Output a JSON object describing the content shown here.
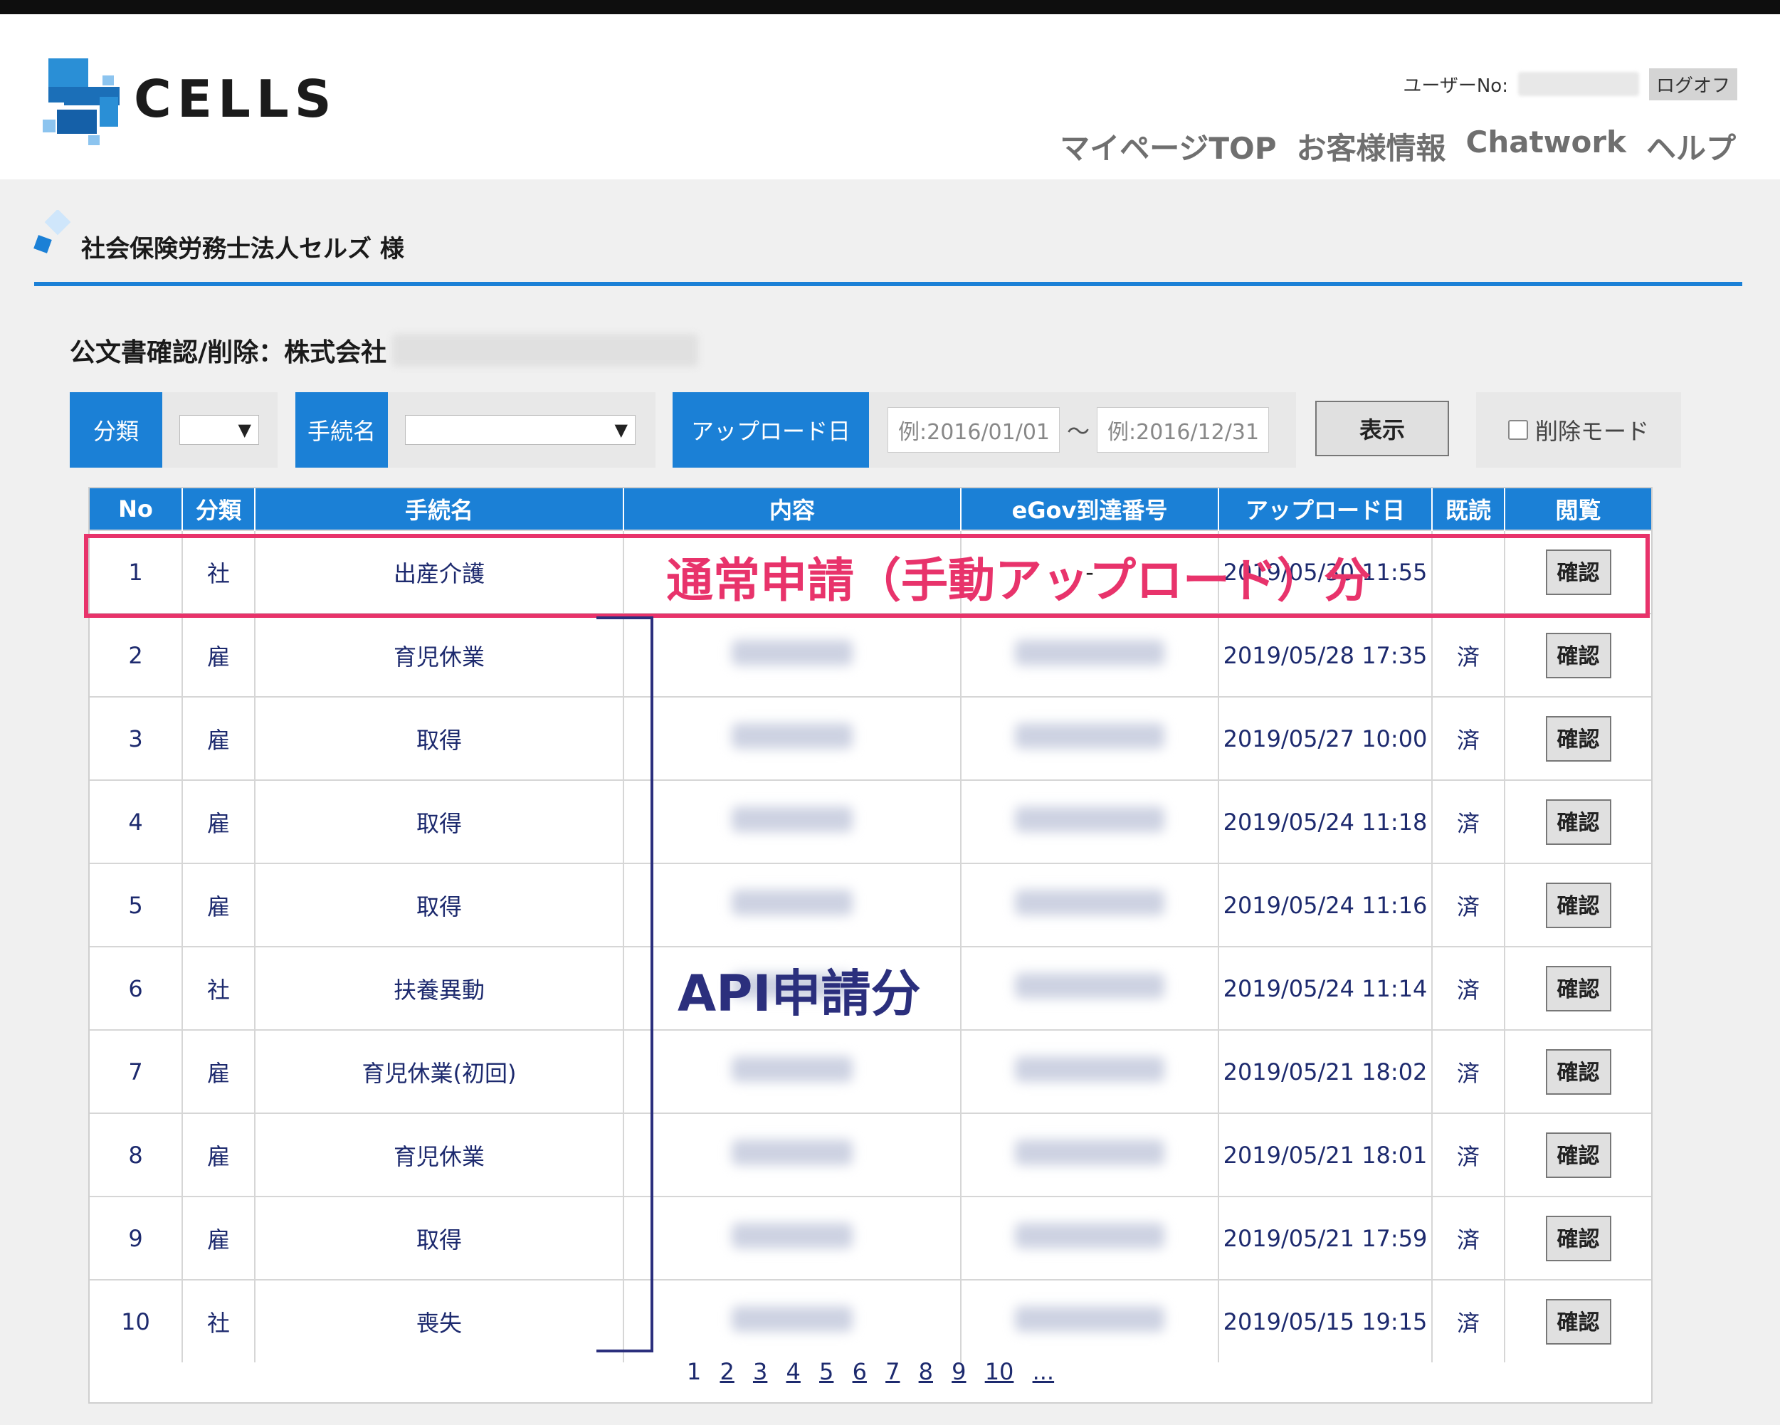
{
  "header": {
    "logo_text": "CELLS",
    "user_label": "ユーザーNo:",
    "logoff_label": "ログオフ",
    "nav": [
      "マイページTOP",
      "お客様情報",
      "Chatwork",
      "ヘルプ"
    ]
  },
  "customer": {
    "name": "社会保険労務士法人セルズ 様"
  },
  "doc_title": "公文書確認/削除：株式会社",
  "filters": {
    "category_label": "分類",
    "procedure_label": "手続名",
    "upload_label": "アップロード日",
    "date_from_placeholder": "例:2016/01/01",
    "tilde": "〜",
    "date_to_placeholder": "例:2016/12/31",
    "show_button": "表示",
    "delete_mode_label": "削除モード"
  },
  "table": {
    "headers": [
      "No",
      "分類",
      "手続名",
      "内容",
      "eGov到達番号",
      "アップロード日",
      "既読",
      "閲覧"
    ],
    "confirm_label": "確認",
    "rows": [
      {
        "no": "1",
        "category": "社",
        "procedure": "出産介護",
        "content": "",
        "egov": "-",
        "upload": "2019/05/30 11:55",
        "read": ""
      },
      {
        "no": "2",
        "category": "雇",
        "procedure": "育児休業",
        "content": "",
        "egov": "",
        "upload": "2019/05/28 17:35",
        "read": "済"
      },
      {
        "no": "3",
        "category": "雇",
        "procedure": "取得",
        "content": "",
        "egov": "",
        "upload": "2019/05/27 10:00",
        "read": "済"
      },
      {
        "no": "4",
        "category": "雇",
        "procedure": "取得",
        "content": "",
        "egov": "",
        "upload": "2019/05/24 11:18",
        "read": "済"
      },
      {
        "no": "5",
        "category": "雇",
        "procedure": "取得",
        "content": "",
        "egov": "",
        "upload": "2019/05/24 11:16",
        "read": "済"
      },
      {
        "no": "6",
        "category": "社",
        "procedure": "扶養異動",
        "content": "",
        "egov": "",
        "upload": "2019/05/24 11:14",
        "read": "済"
      },
      {
        "no": "7",
        "category": "雇",
        "procedure": "育児休業(初回)",
        "content": "",
        "egov": "",
        "upload": "2019/05/21 18:02",
        "read": "済"
      },
      {
        "no": "8",
        "category": "雇",
        "procedure": "育児休業",
        "content": "",
        "egov": "",
        "upload": "2019/05/21 18:01",
        "read": "済"
      },
      {
        "no": "9",
        "category": "雇",
        "procedure": "取得",
        "content": "",
        "egov": "",
        "upload": "2019/05/21 17:59",
        "read": "済"
      },
      {
        "no": "10",
        "category": "社",
        "procedure": "喪失",
        "content": "",
        "egov": "",
        "upload": "2019/05/15 19:15",
        "read": "済"
      }
    ]
  },
  "pagination": {
    "current": "1",
    "pages": [
      "2",
      "3",
      "4",
      "5",
      "6",
      "7",
      "8",
      "9",
      "10"
    ],
    "more": "..."
  },
  "annotations": {
    "manual_label": "通常申請（手動アップロード）分",
    "api_label": "API申請分",
    "manual_color": "#e8336b",
    "api_color": "#2b2f7d"
  },
  "colors": {
    "accent": "#1b80d6"
  }
}
